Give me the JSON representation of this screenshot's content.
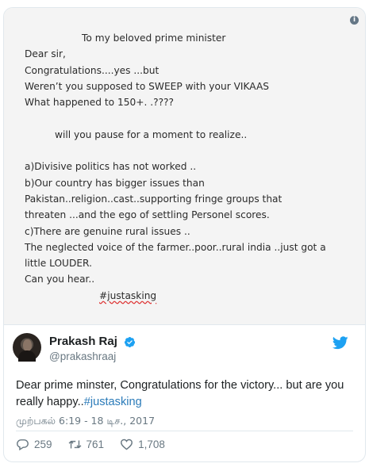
{
  "media": {
    "info_icon": "info-icon",
    "letter_lines": [
      "To my beloved prime minister",
      "Dear sir,",
      "Congratulations....yes ...but",
      "Weren’t you supposed to SWEEP with your VIKAAS",
      "What happened to 150+. .????",
      "",
      "will you pause for a moment to realize..",
      "",
      "a)Divisive politics has not worked ..",
      "b)Our country has bigger issues than",
      "Pakistan..religion..cast..supporting fringe groups that",
      "threaten ...and the ego of settling Personel scores.",
      "c)There are genuine rural issues ..",
      "The neglected voice of the farmer..poor..rural india ..just got a",
      "little LOUDER.",
      "Can you hear..",
      "#justasking"
    ]
  },
  "author": {
    "name": "Prakash Raj",
    "handle": "@prakashraaj",
    "verified_icon": "verified-badge-icon",
    "avatar": "avatar"
  },
  "tweet": {
    "text": "Dear prime minster, Congratulations for the victory... but are you really happy..",
    "hashtag": "#justasking",
    "timestamp": "முற்பகல் 6:19 - 18 டிச., 2017"
  },
  "actions": {
    "reply_count": "259",
    "retweet_count": "761",
    "like_count": "1,708"
  },
  "colors": {
    "link": "#2b7bb9",
    "twitter_blue": "#1da1f2",
    "muted": "#697882"
  }
}
